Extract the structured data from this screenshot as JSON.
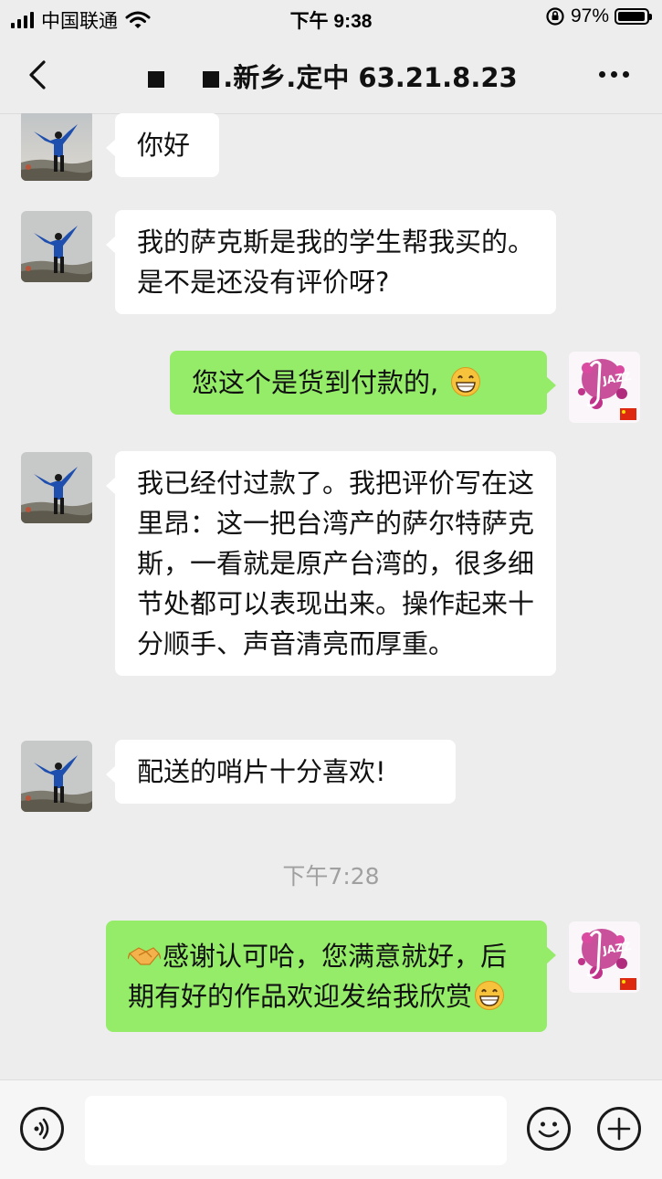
{
  "status_bar": {
    "carrier": "中国联通",
    "time": "下午 9:38",
    "battery": "97%",
    "battery_level": 0.97
  },
  "nav": {
    "title_suffix": ".新乡.定中 63.21.8.23"
  },
  "messages": [
    {
      "side": "in",
      "text": "你好"
    },
    {
      "side": "in",
      "text": "我的萨克斯是我的学生帮我买的。是不是还没有评价呀?"
    },
    {
      "side": "out",
      "text": "您这个是货到付款的,",
      "emoji": "grin-emoji"
    },
    {
      "side": "in",
      "text": "我已经付过款了。我把评价写在这里昂：这一把台湾产的萨尔特萨克斯，一看就是原产台湾的，很多细节处都可以表现出来。操作起来十分顺手、声音清亮而厚重。"
    },
    {
      "side": "in",
      "text": "配送的哨片十分喜欢!"
    },
    {
      "side": "out",
      "text": "感谢认可哈，您满意就好，后期有好的作品欢迎发给我欣赏",
      "emoji_lead": "handshake-emoji",
      "emoji": "grin-emoji"
    }
  ],
  "timestamp": "下午7:28",
  "peer_avatar": "person-on-mountain-avatar",
  "self_avatar": "jazz-saxophone-avatar",
  "self_avatar_text": "JAZZ",
  "colors": {
    "background": "#ededed",
    "incoming_bubble": "#ffffff",
    "outgoing_bubble": "#95ec69"
  }
}
